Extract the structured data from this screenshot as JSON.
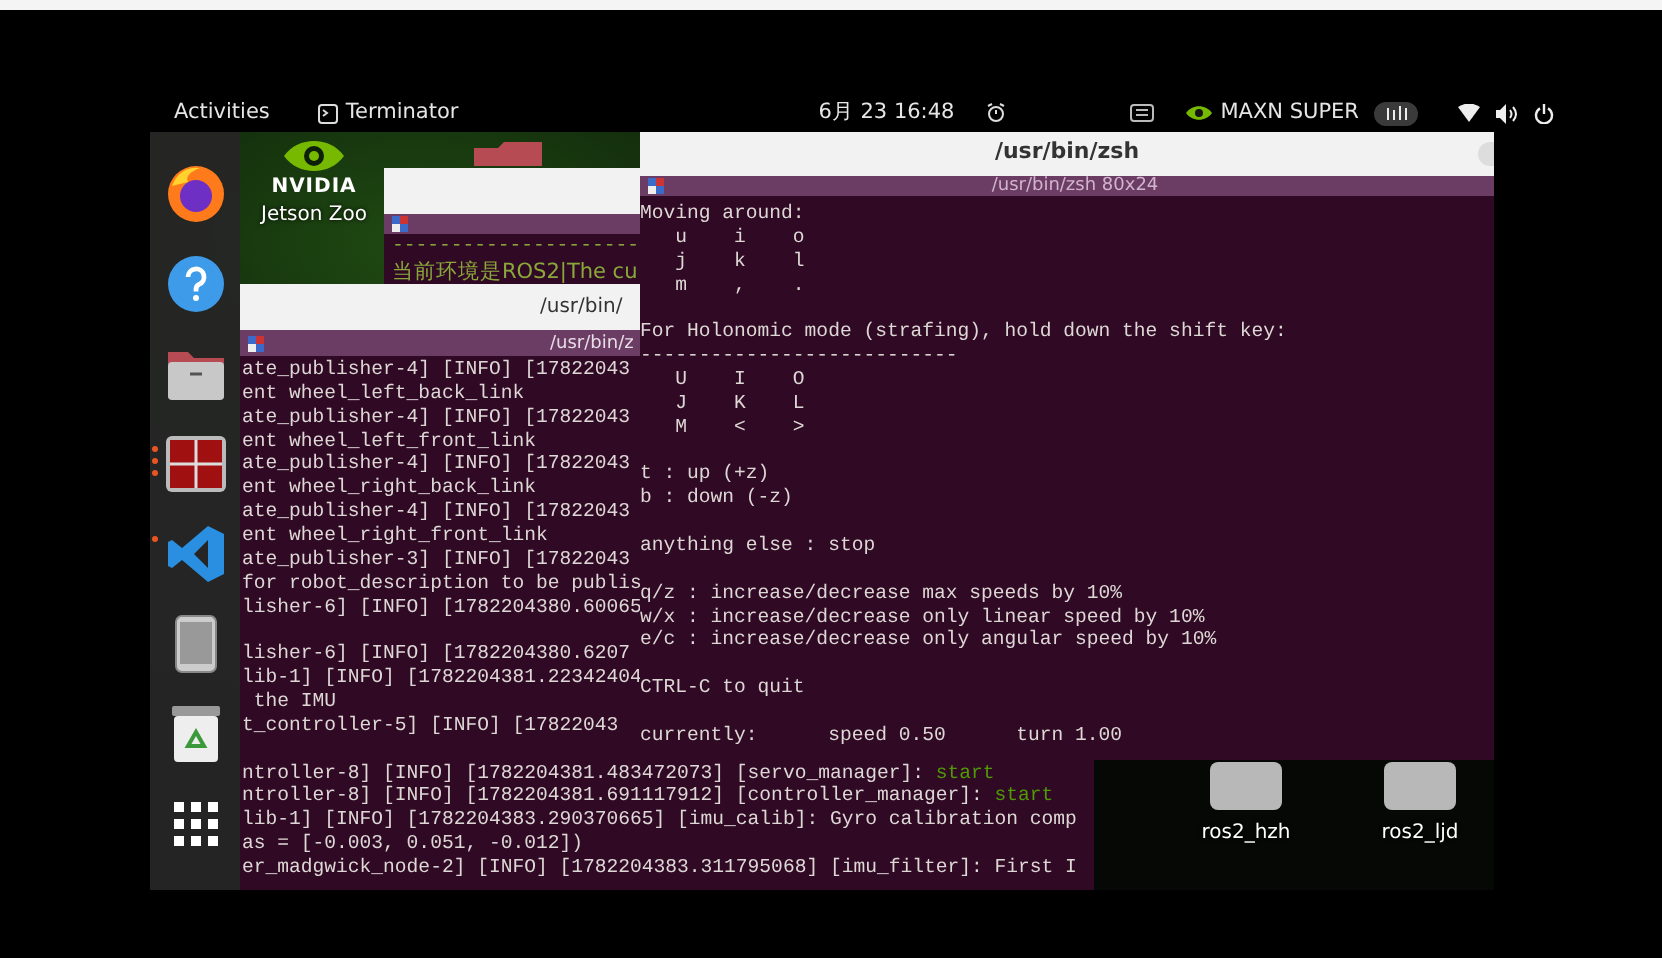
{
  "top_bar": {
    "activities": "Activities",
    "app": "Terminator",
    "clock": "6月 23  16:48",
    "power_mode": "MAXN SUPER"
  },
  "dock": {
    "items": [
      {
        "kind": "firefox",
        "running": false
      },
      {
        "kind": "help",
        "running": false
      },
      {
        "kind": "files",
        "running": false
      },
      {
        "kind": "terminator",
        "running": true
      },
      {
        "kind": "vscode",
        "running": true
      },
      {
        "kind": "device",
        "running": false
      },
      {
        "kind": "trash",
        "running": false
      },
      {
        "kind": "apps",
        "running": false
      }
    ]
  },
  "desktop_icons": [
    {
      "kind": "nvidia",
      "logo": "NVIDIA",
      "label": "Jetson Zoo"
    },
    {
      "kind": "folder",
      "label": "ros2_hzh"
    },
    {
      "kind": "folder",
      "label": "ros2_ljd"
    }
  ],
  "back_terminal": {
    "lines": [
      {
        "text": "---------------------"
      },
      {
        "text": "当前环境是ROS2|The cu"
      }
    ]
  },
  "left_terminal": {
    "title": "/usr/bin/",
    "tab_title": "/usr/bin/z",
    "blocks": [
      [
        {
          "text": "ate_publisher-4] [INFO] [17822043"
        },
        {
          "text": "ent wheel_left_back_link"
        },
        {
          "text": "ate_publisher-4] [INFO] [17822043"
        },
        {
          "text": "ent wheel_left_front_link"
        },
        {
          "text": "ate_publisher-4] [INFO] [17822043"
        },
        {
          "text": "ent wheel_right_back_link"
        },
        {
          "text": "ate_publisher-4] [INFO] [17822043"
        },
        {
          "text": "ent wheel_right_front_link"
        },
        {
          "text": "ate_publisher-3] [INFO] [17822043"
        },
        {
          "text": "for robot_description to be publis"
        },
        {
          "text": "lisher-6] [INFO] [1782204380.60065"
        }
      ],
      [
        {
          "text": "lisher-6] [INFO] [1782204380.6207"
        },
        {
          "text": "lib-1] [INFO] [1782204381.22342404"
        },
        {
          "text": " the IMU"
        },
        {
          "text": "t_controller-5] [INFO] [17822043"
        }
      ],
      [
        {
          "text": "ntroller-8] [INFO] [1782204381.483472073] [servo_manager]: ",
          "status": "start"
        },
        {
          "text": "ntroller-8] [INFO] [1782204381.691117912] [controller_manager]: ",
          "status": "start"
        },
        {
          "text": "lib-1] [INFO] [1782204383.290370665] [imu_calib]: Gyro calibration comp"
        },
        {
          "text": "as = [-0.003, 0.051, -0.012])"
        },
        {
          "text": "er_madgwick_node-2] [INFO] [1782204383.311795068] [imu_filter]: First I"
        }
      ]
    ]
  },
  "right_terminal": {
    "title": "/usr/bin/zsh",
    "tab_title": "/usr/bin/zsh 80x24",
    "blocks": [
      [
        "Moving around:",
        "   u    i    o",
        "   j    k    l",
        "   m    ,    ."
      ],
      [
        "For Holonomic mode (strafing), hold down the shift key:",
        "---------------------------",
        "   U    I    O",
        "   J    K    L",
        "   M    <    >"
      ],
      [
        "t : up (+z)",
        "b : down (-z)"
      ],
      [
        "anything else : stop"
      ],
      [
        "q/z : increase/decrease max speeds by 10%",
        "w/x : increase/decrease only linear speed by 10%",
        "e/c : increase/decrease only angular speed by 10%"
      ],
      [
        "CTRL-C to quit"
      ],
      [
        "currently:      speed 0.50      turn 1.00"
      ]
    ]
  }
}
